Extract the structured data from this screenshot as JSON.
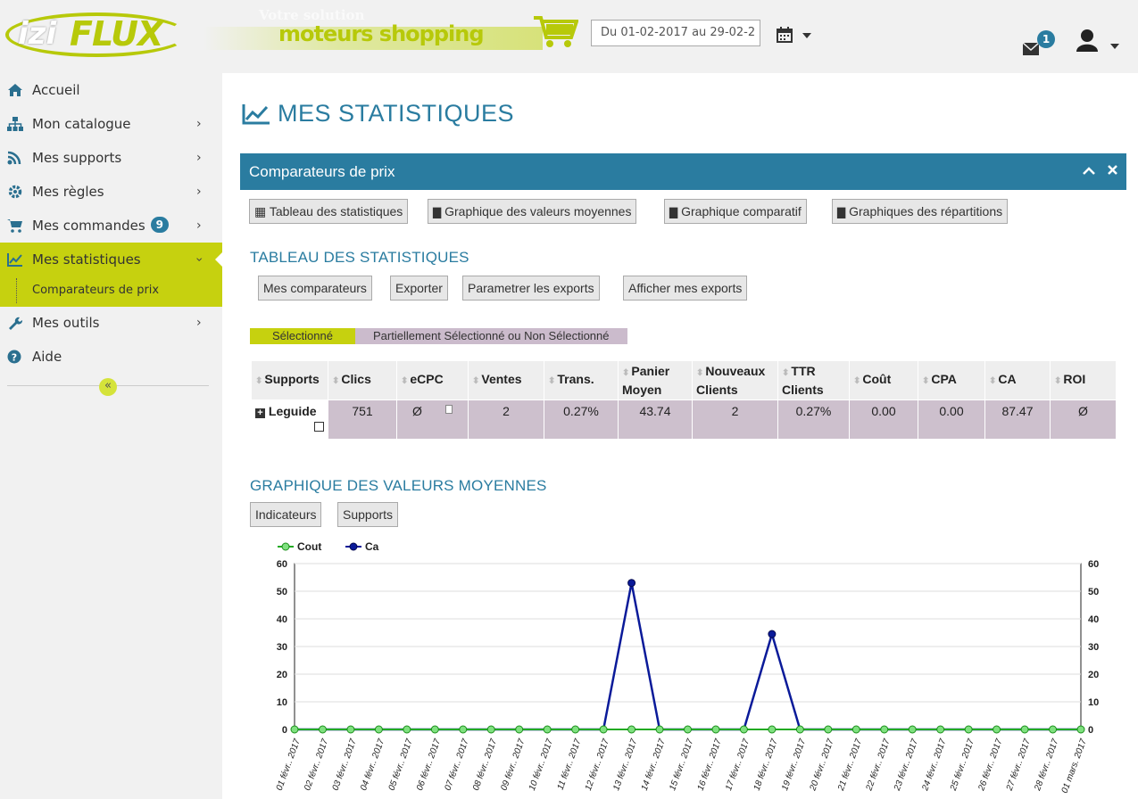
{
  "header": {
    "logo_izi": "izi",
    "logo_flux": "FLUX",
    "slogan_top": "Votre solution",
    "slogan": "moteurs shopping",
    "date_range": "Du 01-02-2017 au 29-02-2",
    "mail_count": "1"
  },
  "sidebar": {
    "items": [
      {
        "label": "Accueil",
        "icon": "home-icon"
      },
      {
        "label": "Mon catalogue",
        "icon": "sitemap-icon"
      },
      {
        "label": "Mes supports",
        "icon": "rss-icon"
      },
      {
        "label": "Mes règles",
        "icon": "gear-icon"
      },
      {
        "label": "Mes commandes",
        "icon": "cart-icon",
        "badge": "9"
      },
      {
        "label": "Mes statistiques",
        "icon": "chart-line-icon"
      },
      {
        "label": "Mes outils",
        "icon": "wrench-icon"
      },
      {
        "label": "Aide",
        "icon": "question-icon"
      }
    ],
    "sub_item": "Comparateurs de prix",
    "collapse_label": "«"
  },
  "main": {
    "title": "MES STATISTIQUES",
    "panel_title": "Comparateurs de prix",
    "view_buttons": [
      "Tableau des statistiques",
      "Graphique des valeurs moyennes",
      "Graphique comparatif",
      "Graphiques des répartitions"
    ],
    "table_section_title": "TABLEAU DES STATISTIQUES",
    "table_buttons": [
      "Mes comparateurs",
      "Exporter",
      "Parametrer les exports",
      "Afficher mes exports"
    ],
    "legend_selected": "Sélectionné",
    "legend_partial": "Partiellement Sélectionné ou Non Sélectionné",
    "table": {
      "headers": [
        "Supports",
        "Clics",
        "eCPC",
        "Ventes",
        "Trans.",
        "Panier Moyen",
        "Nouveaux Clients",
        "TTR Clients",
        "Coût",
        "CPA",
        "CA",
        "ROI"
      ],
      "rows": [
        [
          "Leguide",
          "751",
          "Ø",
          "2",
          "0.27%",
          "43.74",
          "2",
          "0.27%",
          "0.00",
          "0.00",
          "87.47",
          "Ø"
        ]
      ]
    },
    "chart_section_title": "GRAPHIQUE DES VALEURS MOYENNES",
    "chart_buttons": [
      "Indicateurs",
      "Supports"
    ]
  },
  "colors": {
    "accent_blue": "#2a7ca0",
    "accent_lime": "#c6d10f",
    "cout_series": "#22aa22",
    "ca_series": "#0a1a99"
  },
  "chart_data": {
    "type": "line",
    "categories": [
      "01 févr. 2017",
      "02 févr. 2017",
      "03 févr. 2017",
      "04 févr. 2017",
      "05 févr. 2017",
      "06 févr. 2017",
      "07 févr. 2017",
      "08 févr. 2017",
      "09 févr. 2017",
      "10 févr. 2017",
      "11 févr. 2017",
      "12 févr. 2017",
      "13 févr. 2017",
      "14 févr. 2017",
      "15 févr. 2017",
      "16 févr. 2017",
      "17 févr. 2017",
      "18 févr. 2017",
      "19 févr. 2017",
      "20 févr. 2017",
      "21 févr. 2017",
      "22 févr. 2017",
      "23 févr. 2017",
      "24 févr. 2017",
      "25 févr. 2017",
      "26 févr. 2017",
      "27 févr. 2017",
      "28 févr. 2017",
      "01 mars 2017"
    ],
    "tick_labels": [
      "01 févr.. 2017",
      "02 févr.. 2017",
      "03 févr.. 2017",
      "04 févr.. 2017",
      "05 févr.. 2017",
      "06 févr.. 2017",
      "07 févr.. 2017",
      "08 févr.. 2017",
      "09 févr.. 2017",
      "10 févr.. 2017",
      "11 févr.. 2017",
      "12 févr.. 2017",
      "13 févr.. 2017",
      "14 févr.. 2017",
      "15 févr.. 2017",
      "16 févr.. 2017",
      "17 févr.. 2017",
      "18 févr.. 2017",
      "19 févr.. 2017",
      "20 févr.. 2017",
      "21 févr.. 2017",
      "22 févr.. 2017",
      "23 févr.. 2017",
      "24 févr.. 2017",
      "25 févr.. 2017",
      "26 févr.. 2017",
      "27 févr.. 2017",
      "28 févr.. 2017",
      "01 mars. 2017"
    ],
    "series": [
      {
        "name": "Cout",
        "color": "#22aa22",
        "values": [
          0,
          0,
          0,
          0,
          0,
          0,
          0,
          0,
          0,
          0,
          0,
          0,
          0,
          0,
          0,
          0,
          0,
          0,
          0,
          0,
          0,
          0,
          0,
          0,
          0,
          0,
          0,
          0,
          0
        ]
      },
      {
        "name": "Ca",
        "color": "#0a1a99",
        "values": [
          0,
          0,
          0,
          0,
          0,
          0,
          0,
          0,
          0,
          0,
          0,
          0,
          53,
          0,
          0,
          0,
          0,
          34.5,
          0,
          0,
          0,
          0,
          0,
          0,
          0,
          0,
          0,
          0,
          0
        ]
      }
    ],
    "ylim": [
      0,
      60
    ],
    "yticks": [
      0,
      10,
      20,
      30,
      40,
      50,
      60
    ],
    "grid": true,
    "legend": "top-left"
  }
}
